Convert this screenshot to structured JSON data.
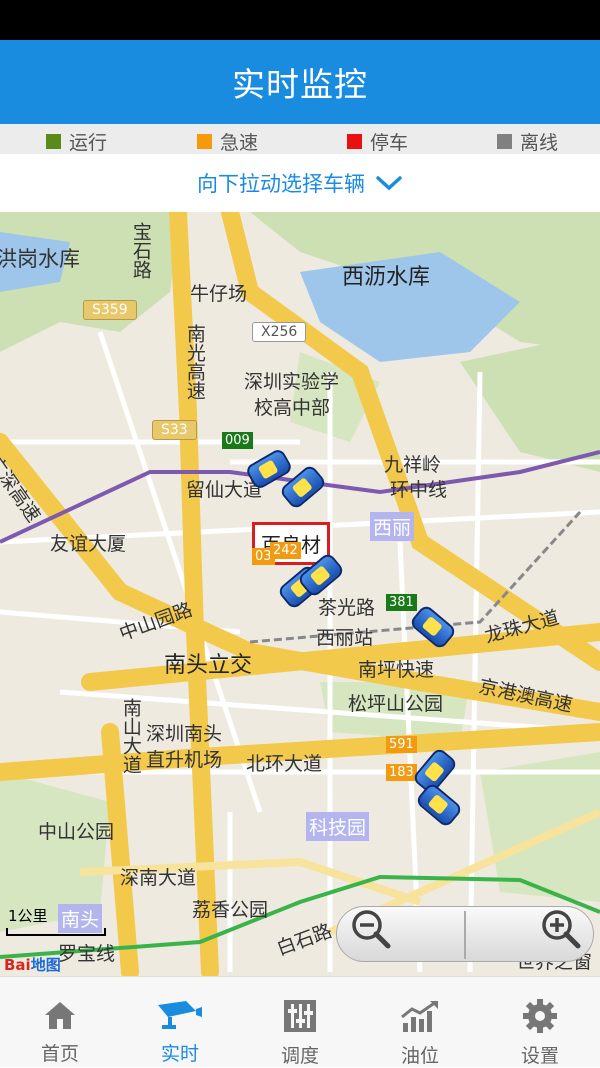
{
  "header": {
    "title": "实时监控"
  },
  "legend": [
    {
      "label": "运行",
      "color": "#5a8a1a"
    },
    {
      "label": "急速",
      "color": "#f59a0a"
    },
    {
      "label": "停车",
      "color": "#e81010"
    },
    {
      "label": "离线",
      "color": "#808080"
    }
  ],
  "selector": {
    "label": "向下拉动选择车辆"
  },
  "map": {
    "labels": [
      "宝石路",
      "牛仔场",
      "西沥水库",
      "深圳实验学",
      "校高中部",
      "九祥岭",
      "留仙大道",
      "环中线",
      "友谊大厦",
      "茶光路",
      "西丽站",
      "龙珠大道",
      "中山园路",
      "南头立交",
      "南坪快速",
      "京港澳高速",
      "松坪山公园",
      "深圳南头",
      "直升机场",
      "北环大道",
      "中山公园",
      "深南大道",
      "荔香公园",
      "白石路",
      "罗宝线",
      "南光高速",
      "南山大道",
      "广深高速",
      "世界之窗",
      "洪岗水库"
    ],
    "shields": [
      "S359",
      "X256",
      "S33"
    ],
    "districts": [
      "西丽",
      "科技园",
      "南头"
    ],
    "vehicle_tags": [
      "009",
      "242",
      "03",
      "381",
      "591",
      "183"
    ],
    "highlighted_vehicle": "百良材",
    "scale_label": "1公里",
    "provider": "Bai",
    "provider_suffix": "地图"
  },
  "tabs": [
    {
      "label": "首页",
      "icon": "home-icon",
      "active": false
    },
    {
      "label": "实时",
      "icon": "camera-icon",
      "active": true
    },
    {
      "label": "调度",
      "icon": "sliders-icon",
      "active": false
    },
    {
      "label": "油位",
      "icon": "chart-icon",
      "active": false
    },
    {
      "label": "设置",
      "icon": "gear-icon",
      "active": false
    }
  ]
}
